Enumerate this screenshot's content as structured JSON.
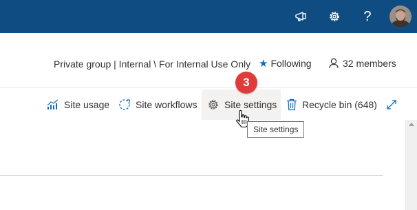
{
  "suite_bar": {
    "background": "#0f4c81",
    "icons": [
      "megaphone-icon",
      "gear-icon",
      "help-icon"
    ],
    "help_glyph": "?"
  },
  "header": {
    "group_info": "Private group | Internal \\ For Internal Use Only",
    "following_label": "Following",
    "members_label": "32 members"
  },
  "command_bar": {
    "site_usage": "Site usage",
    "site_workflows": "Site workflows",
    "site_settings": "Site settings",
    "recycle_bin": "Recycle bin (648)"
  },
  "callout": {
    "step_number": "3",
    "color": "#e03b3b"
  },
  "tooltip": {
    "text": "Site settings"
  },
  "colors": {
    "accent": "#0f6cbd",
    "hover_bg": "#f3f2f1"
  }
}
